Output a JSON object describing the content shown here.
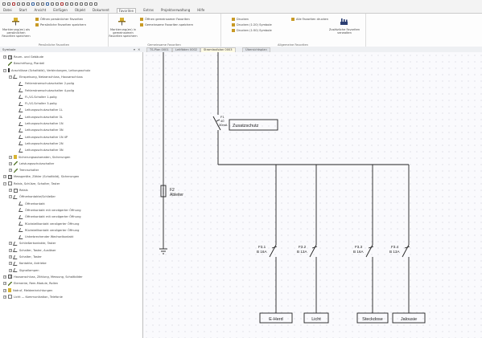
{
  "menu": {
    "items": [
      "Datei",
      "Start",
      "Ansicht",
      "Einfügen",
      "Objekt",
      "Dokument",
      "Favoriten",
      "Extras",
      "Projektverwaltung",
      "Hilfe"
    ],
    "active_index": 6
  },
  "ribbon": {
    "group1": {
      "big_label": "Markierung(en) als persönlichen Favoriten speichern",
      "btn1": "Öffnen persönlicher Favoriten",
      "btn2": "Persönliche Favoriten speichern",
      "label": "Persönliche Favoriten"
    },
    "group2": {
      "big_label": "Markierung(en) in gemeinsamen Favoriten speichern",
      "btn1": "Öffnen gemeinsamer Favoriten",
      "btn2": "Gemeinsame Favoriten speichern",
      "label": "Gemeinsame Favoriten"
    },
    "group3": {
      "btn1": "Drucken",
      "btn2": "Drucken (1:20) Symbole",
      "btn3": "Drucken (1:50) Symbole",
      "btn4": "Alle Favoriten drucken",
      "big_label": "Zusätzliche Favoriten verwalten",
      "label": "Allgemeine Favoriten"
    }
  },
  "panel": {
    "title": "Symbole",
    "controls": "▾ ✕"
  },
  "tabs": [
    {
      "label": "TS-Plan 0001"
    },
    {
      "label": "Leitfäden 0002"
    },
    {
      "label": "Stromlaufplan 0003"
    },
    {
      "label": "Übersichtsplan"
    }
  ],
  "tree": [
    {
      "indent": 0,
      "toggle": "+",
      "icon": "grid",
      "label": "Raum- und Gebäude"
    },
    {
      "indent": 0,
      "toggle": "",
      "icon": "pen",
      "label": "Beschriftung, Planteil"
    },
    {
      "indent": 0,
      "toggle": "−",
      "icon": "blk",
      "label": "Anschlüsse (Schaltbild), Verbindungen, Leitungsschutz"
    },
    {
      "indent": 1,
      "toggle": "−",
      "icon": "sym",
      "label": "Einspeisung, Netzanschluss, Hausanschluss"
    },
    {
      "indent": 2,
      "toggle": "",
      "icon": "sym",
      "label": "Fehlerstromschutzschalter 2-polig"
    },
    {
      "indent": 2,
      "toggle": "",
      "icon": "sym",
      "label": "Fehlerstromschutzschalter 4-polig"
    },
    {
      "indent": 2,
      "toggle": "",
      "icon": "sym",
      "label": "FI-/LS-Schalter 1-polig"
    },
    {
      "indent": 2,
      "toggle": "",
      "icon": "sym",
      "label": "FI-/LS-Schalter 3-polig"
    },
    {
      "indent": 2,
      "toggle": "",
      "icon": "sym",
      "label": "Leitungsschutzschalter 1L"
    },
    {
      "indent": 2,
      "toggle": "",
      "icon": "sym",
      "label": "Leitungsschutzschalter 3L"
    },
    {
      "indent": 2,
      "toggle": "",
      "icon": "sym",
      "label": "Leitungsschutzschalter 1N"
    },
    {
      "indent": 2,
      "toggle": "",
      "icon": "sym",
      "label": "Leitungsschutzschalter 3N"
    },
    {
      "indent": 2,
      "toggle": "",
      "icon": "sym",
      "label": "Leitungsschutzschalter 1N 4P"
    },
    {
      "indent": 2,
      "toggle": "",
      "icon": "sym",
      "label": "Leitungsschutzschalter 2N"
    },
    {
      "indent": 2,
      "toggle": "",
      "icon": "sym",
      "label": "Leitungsschutzschalter 3N"
    },
    {
      "indent": 1,
      "toggle": "+",
      "icon": "yel",
      "label": "Sicherungsautomaten, Sicherungen"
    },
    {
      "indent": 1,
      "toggle": "+",
      "icon": "pen",
      "label": "Leistungsschutzschalter"
    },
    {
      "indent": 1,
      "toggle": "+",
      "icon": "pen",
      "label": "Trennschalter"
    },
    {
      "indent": 0,
      "toggle": "+",
      "icon": "grid",
      "label": "Messgeräte, Zähler (Schaltbild), Sicherungen"
    },
    {
      "indent": 0,
      "toggle": "−",
      "icon": "doc",
      "label": "Relais, Schütze, Schalter, Taster"
    },
    {
      "indent": 1,
      "toggle": "+",
      "icon": "fold",
      "label": "Relais"
    },
    {
      "indent": 1,
      "toggle": "−",
      "icon": "sym",
      "label": "Öffnerkontakte/Schließer"
    },
    {
      "indent": 2,
      "toggle": "",
      "icon": "sym",
      "label": "Öffnerkontakt"
    },
    {
      "indent": 2,
      "toggle": "",
      "icon": "sym",
      "label": "Öffnerkontakt mit verzögerter Öffnung"
    },
    {
      "indent": 2,
      "toggle": "",
      "icon": "sym",
      "label": "Öffnerkontakt mit verzögerter Öffnung"
    },
    {
      "indent": 2,
      "toggle": "",
      "icon": "sym",
      "label": "Rückstellkontakt verzögerter Öffnung"
    },
    {
      "indent": 2,
      "toggle": "",
      "icon": "sym",
      "label": "Rückstellkontakt verzögerter Öffnung"
    },
    {
      "indent": 2,
      "toggle": "",
      "icon": "sym",
      "label": "Unterbrechender Wechselkontakt"
    },
    {
      "indent": 1,
      "toggle": "+",
      "icon": "sym",
      "label": "Schließerkontakte, Taster"
    },
    {
      "indent": 1,
      "toggle": "+",
      "icon": "sym",
      "label": "Schalter, Taster, Auslöser"
    },
    {
      "indent": 1,
      "toggle": "+",
      "icon": "sym",
      "label": "Schalter, Taster"
    },
    {
      "indent": 1,
      "toggle": "+",
      "icon": "sym",
      "label": "Kontakte, Antriebe"
    },
    {
      "indent": 1,
      "toggle": "+",
      "icon": "sym",
      "label": "Signallampen"
    },
    {
      "indent": 0,
      "toggle": "+",
      "icon": "grid",
      "label": "Hausanschluss, Zählung, Messung, Schaltbilder"
    },
    {
      "indent": 0,
      "toggle": "+",
      "icon": "pen",
      "label": "Elemente, Rem-Module, Rollen"
    },
    {
      "indent": 0,
      "toggle": "+",
      "icon": "yel",
      "label": "Notruf, Meldeeinrichtungen"
    },
    {
      "indent": 0,
      "toggle": "+",
      "icon": "doc",
      "label": "Licht — Kommunikation, Telefonie"
    }
  ],
  "schematic": {
    "main_breaker": {
      "name": "F1",
      "type": "40",
      "rating": "30mA"
    },
    "zusatz_label": "Zusatzschutz",
    "arrester": {
      "name": "F2",
      "label": "Ableiter"
    },
    "breakers": [
      {
        "name": "F3.1",
        "rating": "B 16A"
      },
      {
        "name": "F3.2",
        "rating": "B 13A"
      },
      {
        "name": "F3.3",
        "rating": "B 16A"
      },
      {
        "name": "F3.4",
        "rating": "B 13A"
      }
    ],
    "loads": [
      "E-Herd",
      "Licht",
      "Steckdose",
      "Jalousie"
    ]
  }
}
